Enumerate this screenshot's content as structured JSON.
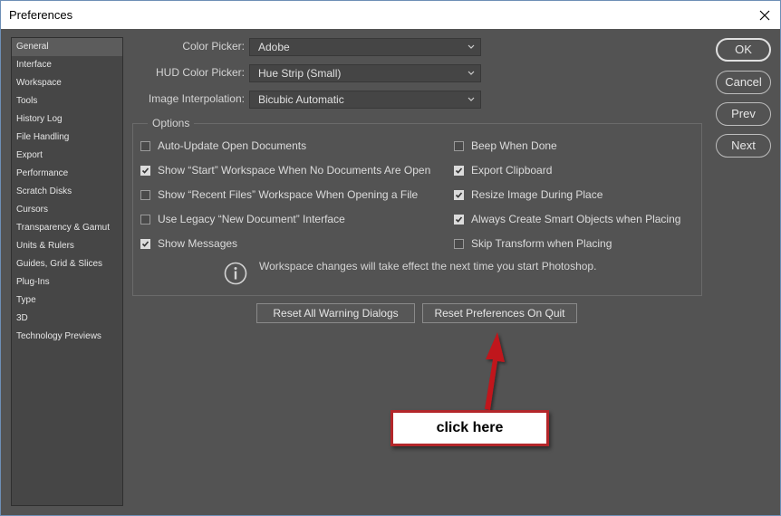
{
  "window": {
    "title": "Preferences"
  },
  "sidebar": {
    "items": [
      {
        "label": "General",
        "selected": true
      },
      {
        "label": "Interface"
      },
      {
        "label": "Workspace"
      },
      {
        "label": "Tools"
      },
      {
        "label": "History Log"
      },
      {
        "label": "File Handling"
      },
      {
        "label": "Export"
      },
      {
        "label": "Performance"
      },
      {
        "label": "Scratch Disks"
      },
      {
        "label": "Cursors"
      },
      {
        "label": "Transparency & Gamut"
      },
      {
        "label": "Units & Rulers"
      },
      {
        "label": "Guides, Grid & Slices"
      },
      {
        "label": "Plug-Ins"
      },
      {
        "label": "Type"
      },
      {
        "label": "3D"
      },
      {
        "label": "Technology Previews"
      }
    ]
  },
  "fields": {
    "color_picker": {
      "label": "Color Picker:",
      "value": "Adobe"
    },
    "hud_color_picker": {
      "label": "HUD Color Picker:",
      "value": "Hue Strip (Small)"
    },
    "image_interpolation": {
      "label": "Image Interpolation:",
      "value": "Bicubic Automatic"
    }
  },
  "options": {
    "title": "Options",
    "left": [
      {
        "label": "Auto-Update Open Documents",
        "checked": false
      },
      {
        "label": "Show “Start” Workspace When No Documents Are Open",
        "checked": true
      },
      {
        "label": "Show “Recent Files” Workspace When Opening a File",
        "checked": false
      },
      {
        "label": "Use Legacy “New Document” Interface",
        "checked": false
      },
      {
        "label": "Show Messages",
        "checked": true
      }
    ],
    "right": [
      {
        "label": "Beep When Done",
        "checked": false
      },
      {
        "label": "Export Clipboard",
        "checked": true
      },
      {
        "label": "Resize Image During Place",
        "checked": true
      },
      {
        "label": "Always Create Smart Objects when Placing",
        "checked": true
      },
      {
        "label": "Skip Transform when Placing",
        "checked": false
      }
    ],
    "info_text": "Workspace changes will take effect the next time you start Photoshop."
  },
  "buttons": {
    "reset_warnings": "Reset All Warning Dialogs",
    "reset_prefs": "Reset Preferences On Quit",
    "ok": "OK",
    "cancel": "Cancel",
    "prev": "Prev",
    "next": "Next"
  },
  "annotation": {
    "callout": "click here",
    "color": "#c0141a"
  },
  "icons": {
    "close": "close-icon",
    "dropdown": "chevron-down-icon",
    "info": "info-icon",
    "check": "checkmark-icon"
  }
}
